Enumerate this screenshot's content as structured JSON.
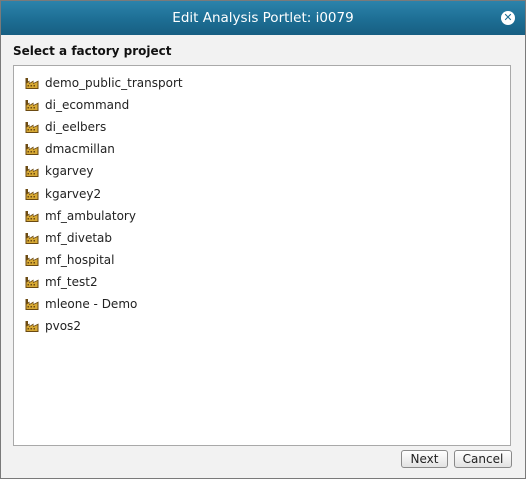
{
  "dialog": {
    "title": "Edit Analysis Portlet: i0079",
    "close_symbol": "✕"
  },
  "prompt": "Select a factory project",
  "projects": [
    {
      "label": "demo_public_transport",
      "icon": "factory-icon"
    },
    {
      "label": "di_ecommand",
      "icon": "factory-icon"
    },
    {
      "label": "di_eelbers",
      "icon": "factory-icon"
    },
    {
      "label": "dmacmillan",
      "icon": "factory-icon"
    },
    {
      "label": "kgarvey",
      "icon": "factory-icon"
    },
    {
      "label": "kgarvey2",
      "icon": "factory-icon"
    },
    {
      "label": "mf_ambulatory",
      "icon": "factory-icon"
    },
    {
      "label": "mf_divetab",
      "icon": "factory-icon"
    },
    {
      "label": "mf_hospital",
      "icon": "factory-icon"
    },
    {
      "label": "mf_test2",
      "icon": "factory-icon"
    },
    {
      "label": "mleone - Demo",
      "icon": "factory-icon"
    },
    {
      "label": "pvos2",
      "icon": "factory-icon"
    }
  ],
  "buttons": {
    "next": "Next",
    "cancel": "Cancel"
  },
  "colors": {
    "titlebar": "#1d6e94",
    "icon_brown": "#6b4a12",
    "icon_gold": "#d7a935"
  }
}
